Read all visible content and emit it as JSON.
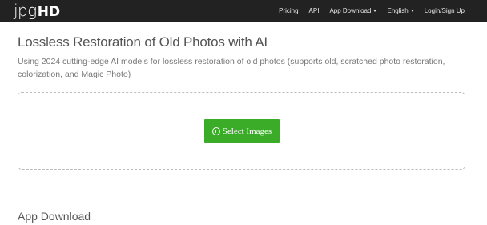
{
  "brand": {
    "logo_light": "jpg",
    "logo_bold": "HD"
  },
  "nav": {
    "items": [
      {
        "label": "Pricing",
        "dropdown": false
      },
      {
        "label": "API",
        "dropdown": false
      },
      {
        "label": "App Download",
        "dropdown": true
      },
      {
        "label": "English",
        "dropdown": true
      },
      {
        "label": "Login/Sign Up",
        "dropdown": false
      }
    ]
  },
  "main": {
    "title": "Lossless Restoration of Old Photos with AI",
    "subtitle": "Using 2024 cutting-edge AI models for lossless restoration of old photos (supports old, scratched photo restoration, colorization, and Magic Photo)",
    "upload": {
      "button_label": "Select Images",
      "icon": "plus-circle-icon"
    }
  },
  "section": {
    "title": "App Download"
  },
  "colors": {
    "navbar": "#222222",
    "accent_green": "#3aac28"
  }
}
